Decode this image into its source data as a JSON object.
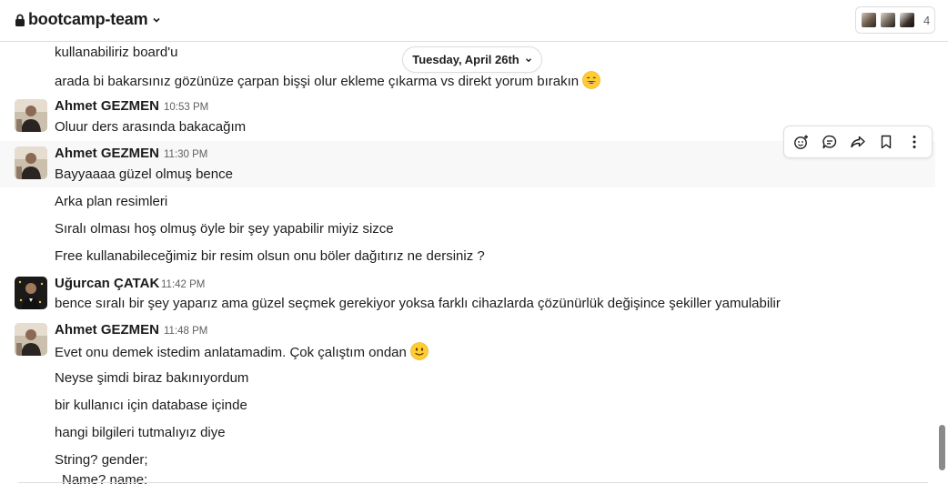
{
  "header": {
    "channel_name": "bootcamp-team",
    "lock_icon": "lock-icon",
    "member_count": "4"
  },
  "date_divider": {
    "label": "Tuesday, April 26th"
  },
  "messages": [
    {
      "text": "kullanabiliriz board'u"
    },
    {
      "text": "arada bi bakarsınız gözünüze çarpan bişşi olur ekleme çıkarma vs direkt yorum bırakın",
      "emoji": "grinning-face"
    },
    {
      "author": "Ahmet GEZMEN",
      "time": "10:53 PM",
      "text": "Oluur ders arasında bakacağım"
    },
    {
      "author": "Ahmet GEZMEN",
      "time": "11:30 PM",
      "text": "Bayyaaaa güzel olmuş bence"
    },
    {
      "text": "Arka plan resimleri"
    },
    {
      "text": "Sıralı olması hoş olmuş öyle bir şey yapabilir miyiz sizce"
    },
    {
      "text": "Free kullanabileceğimiz bir resim olsun onu böler dağıtırız ne dersiniz ?"
    },
    {
      "author": "Uğurcan ÇATAK",
      "time": "11:42 PM",
      "text": "bence sıralı bir şey yaparız ama güzel seçmek gerekiyor yoksa farklı cihazlarda çözünürlük değişince şekiller yamulabilir"
    },
    {
      "author": "Ahmet GEZMEN",
      "time": "11:48 PM",
      "text": "Evet onu demek istedim anlatamadim. Çok çalıştım ondan",
      "emoji": "slightly-smiling-face"
    },
    {
      "text": "Neyse şimdi biraz bakınıyordum"
    },
    {
      "text": "bir kullanıcı için database içinde"
    },
    {
      "text": "hangi bilgileri tutmalıyız diye"
    },
    {
      "text": "String? gender;"
    },
    {
      "text": "Name? name;"
    }
  ],
  "message_actions": [
    "add-reaction-icon",
    "reply-in-thread-icon",
    "share-message-icon",
    "save-for-later-icon",
    "more-actions-icon"
  ],
  "colors": {
    "highlight": "#f8f8f8",
    "border": "#dddddd",
    "text": "#1d1c1d",
    "muted": "#616061"
  }
}
